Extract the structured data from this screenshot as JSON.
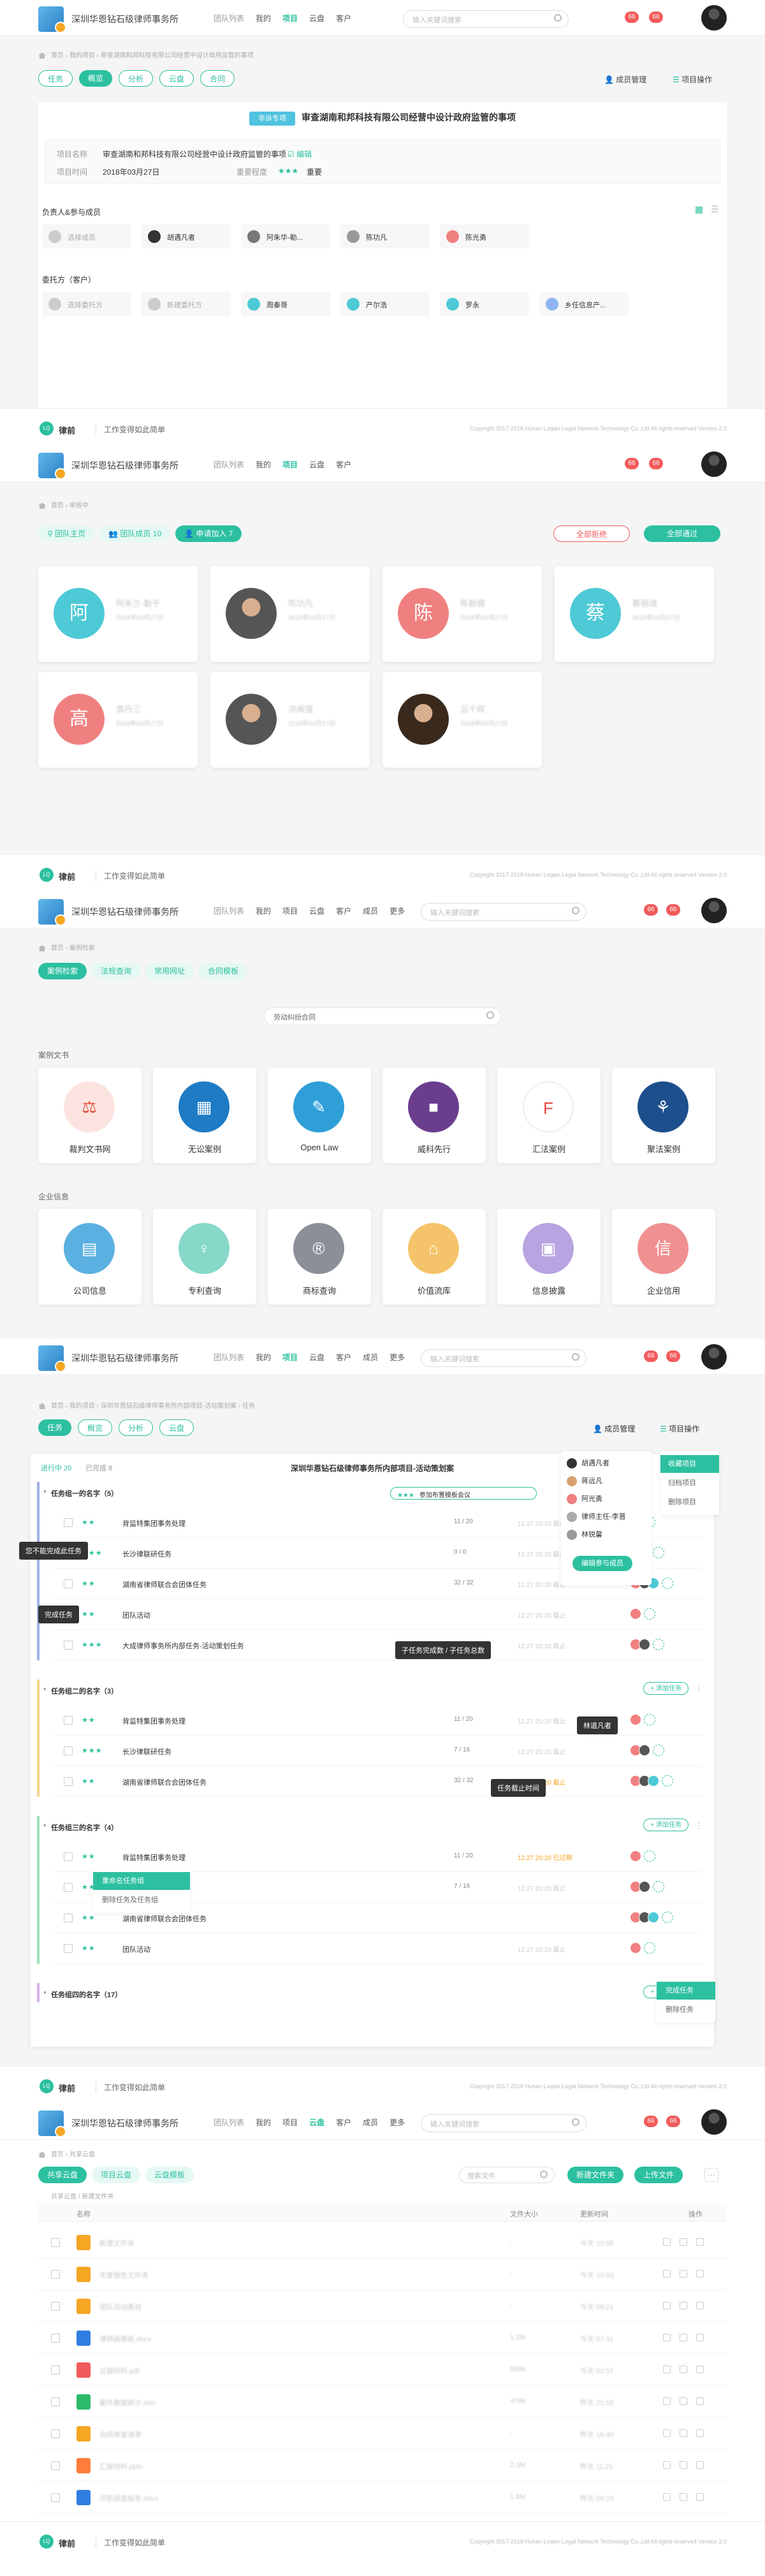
{
  "header": {
    "firm": "深圳华恩钻石级律师事务所",
    "nav": [
      "团队列表",
      "我的",
      "项目",
      "云盘",
      "客户"
    ],
    "nav_more": [
      "团队列表",
      "我的",
      "项目",
      "云盘",
      "客户",
      "成员",
      "更多"
    ],
    "search_placeholder": "输入关键词搜索",
    "badges": [
      "66",
      "66"
    ]
  },
  "footer": {
    "brand": "律前",
    "slogan": "工作变得如此简单",
    "copyright": "Copyright  2017-2018 Hunan Lvqian Legal Network Technology Co.,Ltd All rights reserved  Version 2.0"
  },
  "s1": {
    "crumbs": [
      "首页",
      "我的项目",
      "审查湖南和邦科技有限公司经营中设计政府监管的事项"
    ],
    "tabs": [
      "任务",
      "概览",
      "分析",
      "云盘",
      "合同"
    ],
    "active_tab": "概览",
    "member_btn": "成员管理",
    "ops_btn": "项目操作",
    "tag": "非诉专项",
    "title": "审查湖南和邦科技有限公司经营中设计政府监管的事项",
    "info": [
      {
        "label": "项目名称",
        "value": "审查湖南和邦科技有限公司经营中设计政府监管的事项",
        "extra": "编辑"
      },
      {
        "label": "项目时间",
        "value": "2018年03月27日",
        "label2": "重要程度",
        "value2": "重要"
      }
    ],
    "owners_title": "负责人&参与成员",
    "owners": [
      "选择成员",
      "胡遇凡者",
      "阿朱华-勒...",
      "陈功凡",
      "陈光勇"
    ],
    "parties_title": "委托方（客户）",
    "parties": [
      "选择委托方",
      "新建委托方",
      "周秦哥",
      "产尔浩",
      "罗永",
      "乡任信息产..."
    ]
  },
  "s2": {
    "crumbs": [
      "首页",
      "审核中"
    ],
    "tab1": "团队主页",
    "tab2": "团队成员",
    "tab2_count": "10",
    "tab3": "申请加入",
    "tab3_count": "7",
    "btn_reject": "全部拒绝",
    "btn_accept": "全部通过",
    "members": [
      {
        "ch": "阿",
        "color": "#4ec9d6",
        "name": "阿朱兰-勤于",
        "sub": "2018年03月27日"
      },
      {
        "ch": "",
        "color": "#555",
        "name": "陈功凡",
        "sub": "2018年03月27日",
        "photo": true
      },
      {
        "ch": "陈",
        "color": "#f08080",
        "name": "陈毅儒",
        "sub": "2018年03月27日"
      },
      {
        "ch": "蔡",
        "color": "#4ec9d6",
        "name": "蔡丽靖",
        "sub": "2018年03月27日"
      },
      {
        "ch": "高",
        "color": "#f08080",
        "name": "高丹三",
        "sub": "2018年03月27日"
      },
      {
        "ch": "",
        "color": "#555",
        "name": "洪闻强",
        "sub": "2018年03月27日",
        "photo": true
      },
      {
        "ch": "",
        "color": "#3a2a1e",
        "name": "吕千晖",
        "sub": "2018年03月27日",
        "photo": true
      }
    ]
  },
  "s3": {
    "crumbs": [
      "首页",
      "案例检索"
    ],
    "tabs": [
      "案例检索",
      "法规查询",
      "常用网址",
      "合同模板"
    ],
    "search_placeholder": "劳动纠纷合同",
    "sec1": "案例文书",
    "tools1": [
      {
        "name": "裁判文书网",
        "color": "#fbe4df",
        "fg": "#e64a3b"
      },
      {
        "name": "无讼案例",
        "color": "#1e7bc4",
        "fg": "#fff"
      },
      {
        "name": "Open Law",
        "color": "#2f9fd8",
        "fg": "#fff"
      },
      {
        "name": "威科先行",
        "color": "#6a3d8e",
        "fg": "#fff"
      },
      {
        "name": "汇法案例",
        "color": "#fff",
        "fg": "#e64a3b"
      },
      {
        "name": "聚法案例",
        "color": "#1d4f8c",
        "fg": "#fff"
      }
    ],
    "sec2": "企业信息",
    "tools2": [
      {
        "name": "公司信息",
        "color": "#5ab0e0"
      },
      {
        "name": "专利查询",
        "color": "#86d8c8"
      },
      {
        "name": "商标查询",
        "color": "#8a8f98"
      },
      {
        "name": "价值流库",
        "color": "#f5c46a"
      },
      {
        "name": "信息披露",
        "color": "#b7a4e0"
      },
      {
        "name": "企业信用",
        "color": "#f09090"
      }
    ]
  },
  "s4": {
    "crumbs": [
      "首页",
      "我的项目",
      "深圳华恩钻石级律师事务所内部项目-活动策划案",
      "任务"
    ],
    "tabs": [
      "任务",
      "概览",
      "分析",
      "云盘"
    ],
    "member_btn": "成员管理",
    "ops_btn": "项目操作",
    "count1": "进行中 20",
    "count2": "已完成 8",
    "title": "深圳华恩钻石级律师事务所内部项目-活动策划案",
    "progress_label": "参加布置模板会议",
    "groups": [
      {
        "name": "任务组一的名字（5）",
        "color": "#9db1e8",
        "tasks": [
          {
            "name": "背监特集团事务处理",
            "p": "11 / 20",
            "d": "12.27 20:20 截止"
          },
          {
            "name": "长沙律联研任务",
            "p": "0 / 0",
            "d": "12.27 20:20 截止"
          },
          {
            "name": "湖南省律师联合会团体任务",
            "p": "32 / 32",
            "d": "12.27 20:20 截止"
          },
          {
            "name": "团队活动",
            "p": "",
            "d": "12.27 20:20 截止"
          },
          {
            "name": "大成律师事务所内部任务-活动策划任务",
            "p": "2 / 4",
            "d": "12.27 20:20 截止"
          }
        ]
      },
      {
        "name": "任务组二的名字（3）",
        "color": "#f5d48a",
        "tasks": [
          {
            "name": "背监特集团事务处理",
            "p": "11 / 20",
            "d": "12.27 20:20 截止"
          },
          {
            "name": "长沙律联研任务",
            "p": "7 / 16",
            "d": "12.27 20:20 截止"
          },
          {
            "name": "湖南省律师联合会团体任务",
            "p": "32 / 32",
            "d": "12.27 20:20 截止"
          }
        ]
      },
      {
        "name": "任务组三的名字（4）",
        "color": "#9be0b8",
        "tasks": [
          {
            "name": "背监特集团事务处理",
            "p": "11 / 20",
            "d": "12.27 20:20 已过期"
          },
          {
            "name": "长沙律联研任务",
            "p": "7 / 16",
            "d": "12.27 20:20 截止"
          },
          {
            "name": "湖南省律师联合会团体任务",
            "p": "",
            "d": ""
          },
          {
            "name": "团队活动",
            "p": "",
            "d": "12.27 20:20 截止"
          }
        ]
      },
      {
        "name": "任务组四的名字（17）",
        "color": "#d4b3e8",
        "tasks": []
      }
    ],
    "add_task": "+ 添加任务",
    "tips": {
      "t1": "您不能完成此任务",
      "t2": "完成任务",
      "t3": "子任务完成数 / 子任务总数",
      "t4": "林道凡者",
      "t5": "任务截止时间"
    },
    "menu": [
      "胡遇凡者",
      "蒋远凡",
      "阿光勇",
      "律师主任-李晋",
      "林锐馨"
    ],
    "menu_btn": "编辑参与成员",
    "ops_menu": [
      "收藏项目",
      "归档项目",
      "删除项目"
    ],
    "ctx_menu": [
      "重命名任务组",
      "删除任务及任务组"
    ],
    "done_menu": [
      "完成任务",
      "删除任务"
    ]
  },
  "s5": {
    "crumbs": [
      "首页",
      "共享云盘"
    ],
    "tabs": [
      "共享云盘",
      "项目云盘",
      "云盘模板"
    ],
    "search_placeholder": "搜索文件",
    "btn_new": "新建文件夹",
    "btn_upload": "上传文件",
    "path": "共享云盘 / 新建文件夹",
    "cols": [
      "名称",
      "文件大小",
      "更新时间",
      "操作"
    ],
    "rows": [
      {
        "icon": "#f5a623",
        "name": "新建文件夹",
        "size": "-",
        "time": "今天 10:55"
      },
      {
        "icon": "#f5a623",
        "name": "年度报告文件夹",
        "size": "-",
        "time": "今天 10:03"
      },
      {
        "icon": "#f5a623",
        "name": "团队活动素材",
        "size": "-",
        "time": "今天 09:21"
      },
      {
        "icon": "#2f7de1",
        "name": "律师函模板.docx",
        "size": "1.2M",
        "time": "今天 07:31"
      },
      {
        "icon": "#f15b5b",
        "name": "证据材料.pdf",
        "size": "865K",
        "time": "今天 02:57"
      },
      {
        "icon": "#2cb96a",
        "name": "案件数据统计.xlsx",
        "size": "476K",
        "time": "昨天 21:55"
      },
      {
        "icon": "#f5a623",
        "name": "合同审查清单",
        "size": "-",
        "time": "昨天 15:40"
      },
      {
        "icon": "#ff7d3a",
        "name": "汇报材料.pptx",
        "size": "2.3M",
        "time": "昨天 11:21"
      },
      {
        "icon": "#2f7de1",
        "name": "尽职调查报告.docx",
        "size": "1.8M",
        "time": "昨天 09:23"
      }
    ]
  }
}
